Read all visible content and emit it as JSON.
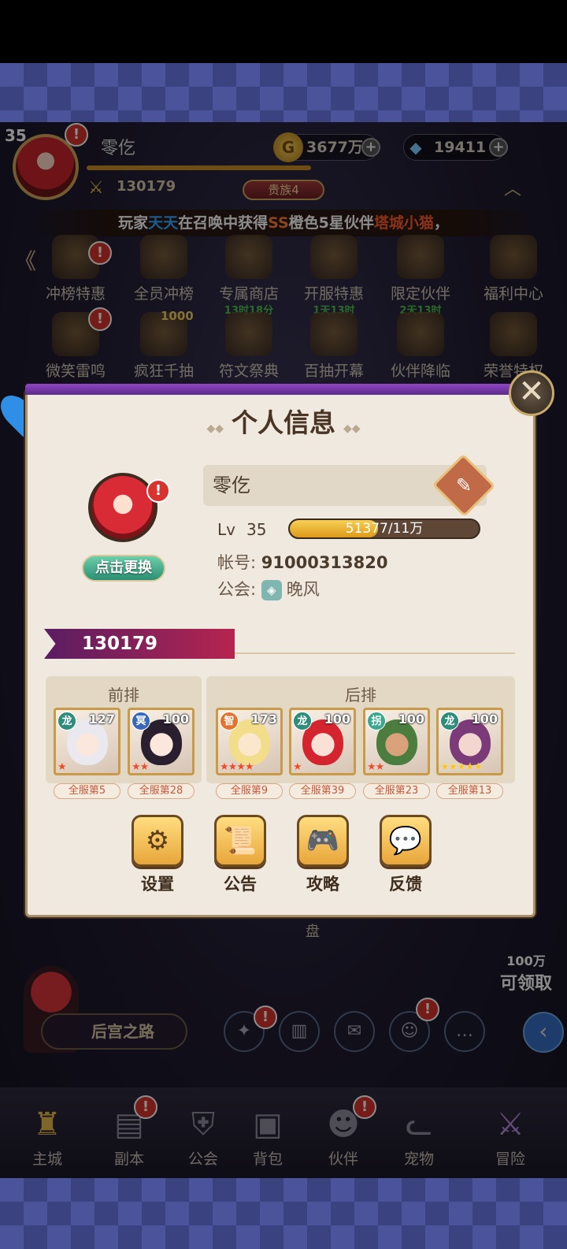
{
  "hud": {
    "level": "35",
    "player_name": "零仡",
    "power": "130179",
    "vip": "贵族4",
    "gold": "3677万",
    "diamond": "19411",
    "alert": "!"
  },
  "marquee": {
    "prefix": "玩家",
    "player": "天天",
    "mid1": "在召唤中获得",
    "quality": "SS",
    "mid2": "橙色5星伙伴",
    "partner": "塔城小猫",
    "suffix": "，"
  },
  "activities_row1": [
    {
      "label": "冲榜特惠",
      "timer": ""
    },
    {
      "label": "全员冲榜",
      "timer": ""
    },
    {
      "label": "专属商店",
      "timer": "13时18分"
    },
    {
      "label": "开服特惠",
      "timer": "1天13时"
    },
    {
      "label": "限定伙伴",
      "timer": "2天13时"
    },
    {
      "label": "福利中心",
      "timer": ""
    }
  ],
  "activities_row2": [
    {
      "label": "微笑雷鸣"
    },
    {
      "label": "疯狂千抽",
      "badge": "1000"
    },
    {
      "label": "符文祭典"
    },
    {
      "label": "百抽开幕"
    },
    {
      "label": "伙伴降临"
    },
    {
      "label": "荣誉特权"
    }
  ],
  "modal": {
    "title": "个人信息",
    "change_avatar": "点击更换",
    "name": "零仡",
    "level_label": "Lv",
    "level": "35",
    "xp_text": "51377/11万",
    "xp_fraction": 0.467,
    "account_label": "帐号:",
    "account": "91000313820",
    "guild_label": "公会:",
    "guild": "晚风",
    "power": "130179",
    "front_label": "前排",
    "back_label": "后排",
    "front": [
      {
        "clan": "龙",
        "level": "127",
        "stars": "★",
        "rank": "全服第5"
      },
      {
        "clan": "冥",
        "level": "100",
        "stars": "★★",
        "rank": "全服第28"
      }
    ],
    "back": [
      {
        "clan": "智",
        "level": "173",
        "stars": "★★★★",
        "rank": "全服第9"
      },
      {
        "clan": "龙",
        "level": "100",
        "stars": "★",
        "rank": "全服第39"
      },
      {
        "clan": "拐",
        "level": "100",
        "stars": "★★",
        "rank": "全服第23"
      },
      {
        "clan": "龙",
        "level": "100",
        "stars": "★★★★★",
        "rank": "全服第13"
      }
    ],
    "actions": [
      {
        "label": "设置",
        "icon": "gear-icon"
      },
      {
        "label": "公告",
        "icon": "scroll-icon"
      },
      {
        "label": "攻略",
        "icon": "gamepad-icon"
      },
      {
        "label": "反馈",
        "icon": "chat-icon"
      }
    ]
  },
  "bottom": {
    "road": "后宫之路",
    "disc": "盘",
    "claim_amount": "100万",
    "claim_label": "可领取",
    "nav": [
      "主城",
      "副本",
      "公会",
      "背包",
      "伙伴",
      "宠物",
      "冒险"
    ]
  }
}
